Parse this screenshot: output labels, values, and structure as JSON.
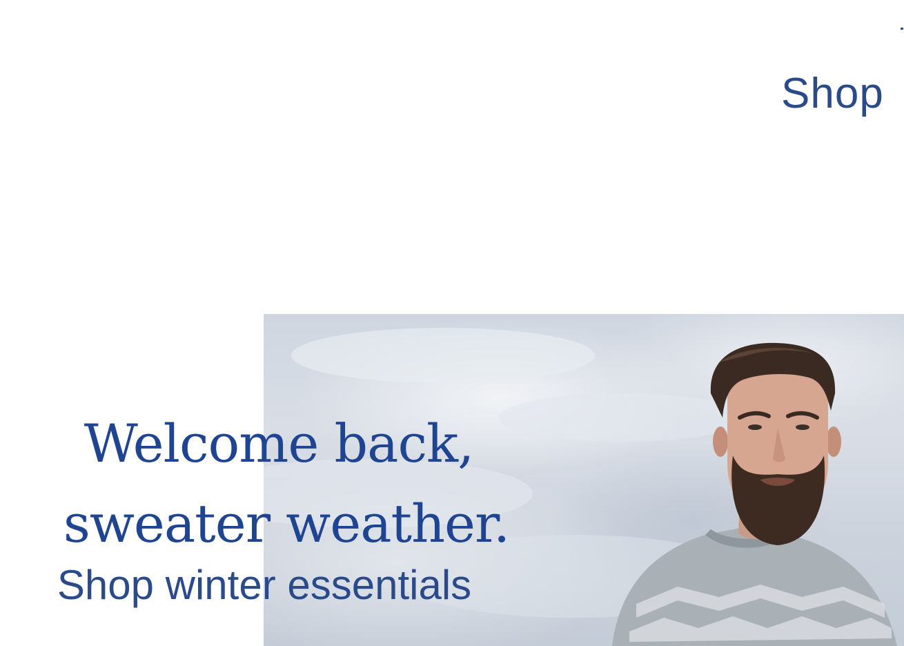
{
  "header": {
    "nav_shop_label": "Shop"
  },
  "hero": {
    "headline_line1": "Welcome back,",
    "headline_line2": "sweater weather.",
    "cta_label": "Shop winter essentials",
    "image_subject": "bearded man in knit sweater against cloudy sky"
  },
  "colors": {
    "brand_blue": "#1f4592",
    "nav_blue": "#2a4a8a",
    "background": "#ffffff"
  }
}
